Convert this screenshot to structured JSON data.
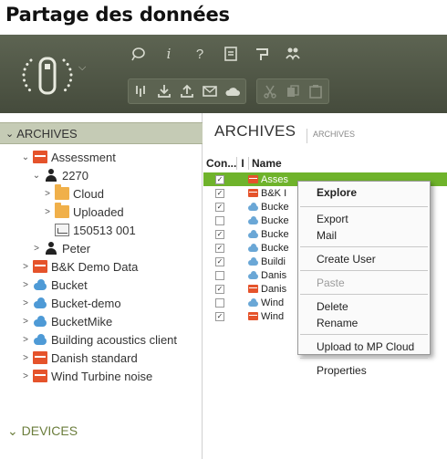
{
  "page": {
    "heading": "Partage des données"
  },
  "toolbar": {
    "row1_icons": [
      "feedback-icon",
      "info-icon",
      "help-icon",
      "document-icon",
      "flag-icon",
      "users-icon"
    ],
    "row2_icons": [
      "import-icon",
      "download-icon",
      "upload-icon",
      "mail-icon",
      "cloud-icon",
      "cut-icon",
      "copy-icon",
      "paste-icon"
    ]
  },
  "left_pane": {
    "header": "ARCHIVES",
    "tree": [
      {
        "label": "Assessment",
        "icon": "archive",
        "level": 1,
        "toggle": "expanded"
      },
      {
        "label": "2270",
        "icon": "user",
        "level": 2,
        "toggle": "expanded"
      },
      {
        "label": "Cloud",
        "icon": "folder",
        "level": 3,
        "toggle": "collapsed"
      },
      {
        "label": "Uploaded",
        "icon": "folder",
        "level": 3,
        "toggle": "collapsed"
      },
      {
        "label": "150513 001",
        "icon": "measure",
        "level": 3,
        "toggle": "none"
      },
      {
        "label": "Peter",
        "icon": "user",
        "level": 2,
        "toggle": "collapsed"
      },
      {
        "label": "B&K Demo Data",
        "icon": "archive",
        "level": 1,
        "toggle": "collapsed"
      },
      {
        "label": "Bucket",
        "icon": "cloud",
        "level": 1,
        "toggle": "collapsed"
      },
      {
        "label": "Bucket-demo",
        "icon": "cloud",
        "level": 1,
        "toggle": "collapsed"
      },
      {
        "label": "BucketMike",
        "icon": "cloud",
        "level": 1,
        "toggle": "collapsed"
      },
      {
        "label": "Building acoustics client",
        "icon": "cloud",
        "level": 1,
        "toggle": "collapsed"
      },
      {
        "label": "Danish standard",
        "icon": "archive",
        "level": 1,
        "toggle": "collapsed"
      },
      {
        "label": "Wind Turbine noise",
        "icon": "archive",
        "level": 1,
        "toggle": "collapsed"
      }
    ],
    "devices_label": "DEVICES",
    "chevron_expanded": "⌄",
    "chevron_collapsed": ">"
  },
  "right_pane": {
    "title": "ARCHIVES",
    "subtitle": "ARCHIVES",
    "columns": [
      "Con...",
      "I",
      "Name"
    ],
    "rows": [
      {
        "checked": true,
        "icon": "archive",
        "name": "Asses",
        "selected": true
      },
      {
        "checked": true,
        "icon": "archive",
        "name": "B&K I",
        "selected": false
      },
      {
        "checked": true,
        "icon": "cloud",
        "name": "Bucke",
        "selected": false
      },
      {
        "checked": false,
        "icon": "cloud",
        "name": "Bucke",
        "selected": false
      },
      {
        "checked": true,
        "icon": "cloud",
        "name": "Bucke",
        "selected": false
      },
      {
        "checked": true,
        "icon": "cloud",
        "name": "Bucke",
        "selected": false
      },
      {
        "checked": true,
        "icon": "cloud",
        "name": "Buildi",
        "selected": false
      },
      {
        "checked": false,
        "icon": "cloud",
        "name": "Danis",
        "selected": false
      },
      {
        "checked": true,
        "icon": "archive",
        "name": "Danis",
        "selected": false
      },
      {
        "checked": false,
        "icon": "cloud",
        "name": "Wind",
        "selected": false
      },
      {
        "checked": true,
        "icon": "archive",
        "name": "Wind",
        "selected": false
      }
    ],
    "check_mark": "✓"
  },
  "context_menu": {
    "explore": "Explore",
    "export": "Export",
    "mail": "Mail",
    "create_user": "Create User",
    "paste": "Paste",
    "delete": "Delete",
    "rename": "Rename",
    "upload": "Upload to MP Cloud",
    "properties": "Properties"
  },
  "colors": {
    "selection": "#6fb32b",
    "toolbar": "#4f5646",
    "archive_icon": "#e5532b",
    "cloud_icon": "#4e9ad6",
    "devices_text": "#6b7d3c"
  }
}
